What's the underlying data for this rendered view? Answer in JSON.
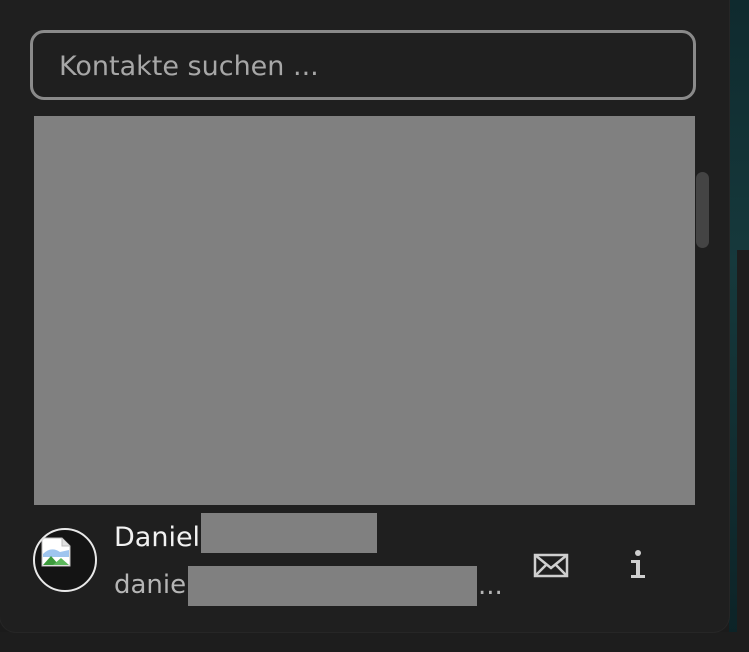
{
  "search": {
    "placeholder": "Kontakte suchen ..."
  },
  "contact": {
    "first_name": "Daniel",
    "email_prefix": "danie",
    "email_suffix": "..."
  },
  "icons": {
    "avatar": "broken-image-icon",
    "email": "envelope-icon",
    "info": "info-icon"
  },
  "colors": {
    "panel_background": "#1f1f1f",
    "search_border": "#8a8a8a",
    "redaction": "#808080",
    "text_primary": "#f2f2f2",
    "text_secondary": "#b5b5b5"
  }
}
